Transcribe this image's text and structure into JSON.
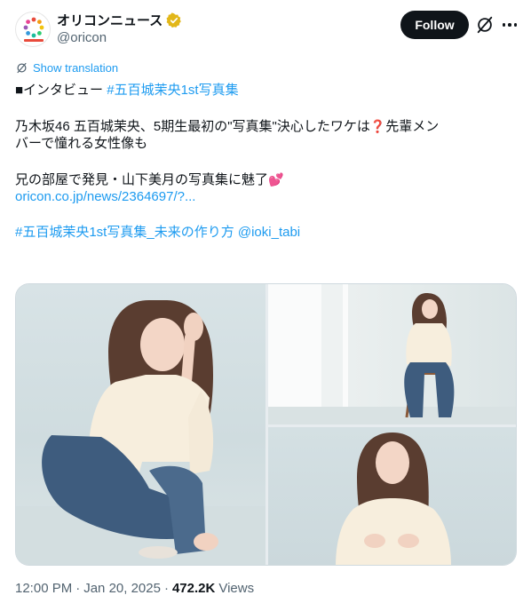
{
  "account": {
    "display_name": "オリコンニュース",
    "handle": "@oricon",
    "avatar_icon": "oricon-logo-icon",
    "verified_icon": "gold-verified-badge-icon",
    "verified_color": "#e2b719"
  },
  "actions": {
    "follow_label": "Follow",
    "grok_icon": "grok-icon",
    "more_icon": "more-options-icon"
  },
  "translation": {
    "label": "Show translation",
    "icon": "translate-icon"
  },
  "text": {
    "line1_prefix": "■インタビュー ",
    "line1_hashtag": "#五百城茉央1st写真集",
    "line2": "乃木坂46 五百城茉央、5期生最初の\"写真集\"決心したワケは",
    "line2_emoji": "❓",
    "line2_tail": "先輩メン",
    "line3": "バーで憧れる女性像も",
    "line4": "兄の部屋で発見・山下美月の写真集に魅了",
    "line4_emoji": "💕",
    "link": "oricon.co.jp/news/2364697/?...",
    "hashtag_line_1": "#五百城茉央1st写真集_未来の作り方",
    "mention": "@ioki_tabi"
  },
  "media": {
    "photos": [
      {
        "label": "photo-woman-crouching"
      },
      {
        "label": "photo-woman-on-stool"
      },
      {
        "label": "photo-woman-portrait"
      }
    ]
  },
  "footer": {
    "time": "12:00 PM",
    "separator": "·",
    "date": "Jan 20, 2025",
    "separator2": "·",
    "views_count": "472.2K",
    "views_label": "Views"
  },
  "colors": {
    "link": "#1d9bf0",
    "text": "#0f1419",
    "secondary": "#536471",
    "follow_bg": "#0f1419"
  }
}
